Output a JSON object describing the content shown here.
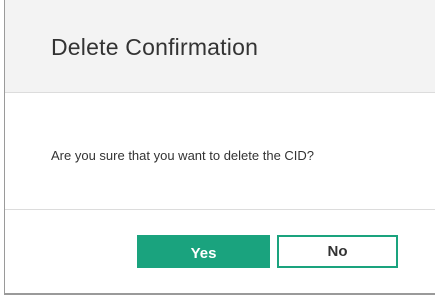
{
  "dialog": {
    "title": "Delete Confirmation",
    "message": "Are you sure that you want to delete the CID?",
    "buttons": {
      "yes_label": "Yes",
      "no_label": "No"
    }
  },
  "colors": {
    "accent": "#1aa37e",
    "header_background": "#f3f3f3",
    "text": "#333333"
  }
}
